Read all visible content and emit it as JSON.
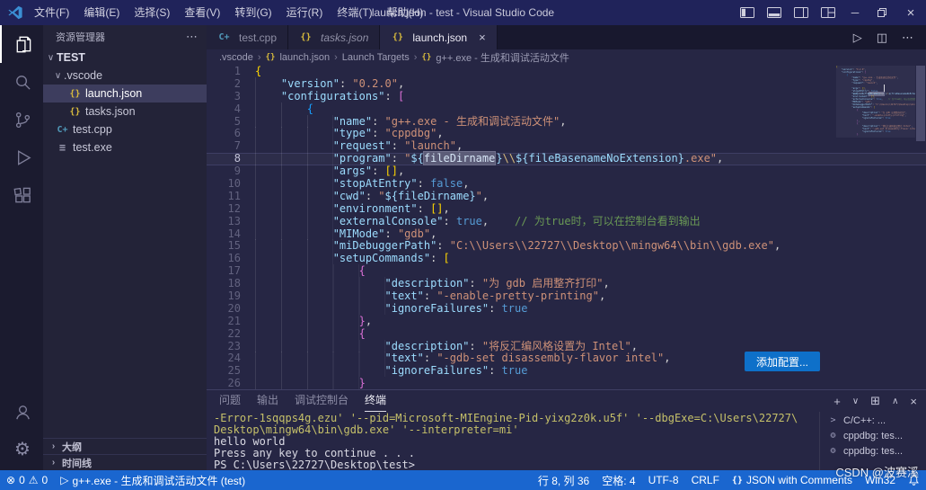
{
  "window": {
    "title": "launch.json - test - Visual Studio Code"
  },
  "menu_bar": {
    "items": [
      "文件(F)",
      "编辑(E)",
      "选择(S)",
      "查看(V)",
      "转到(G)",
      "运行(R)",
      "终端(T)",
      "帮助(H)"
    ]
  },
  "activity_bar": {
    "icons": [
      "explorer",
      "search",
      "source-control",
      "run-and-debug",
      "extensions"
    ],
    "bottom": [
      "account",
      "settings"
    ]
  },
  "explorer": {
    "header": "资源管理器",
    "tree": [
      {
        "label": "TEST",
        "chevron": "down",
        "pad": 2,
        "bold": true
      },
      {
        "label": ".vscode",
        "chevron": "down",
        "pad": 10
      },
      {
        "label": "launch.json",
        "icon": "json",
        "pad": 28,
        "selected": true
      },
      {
        "label": "tasks.json",
        "icon": "json",
        "pad": 28
      },
      {
        "label": "test.cpp",
        "icon": "cpp",
        "pad": 14
      },
      {
        "label": "test.exe",
        "icon": "exe",
        "pad": 14
      }
    ],
    "sections": [
      "大纲",
      "时间线"
    ]
  },
  "tabs": [
    {
      "label": "test.cpp",
      "icon": "cpp"
    },
    {
      "label": "tasks.json",
      "icon": "json",
      "italic": true
    },
    {
      "label": "launch.json",
      "icon": "json",
      "active": true
    }
  ],
  "breadcrumb": [
    {
      "label": ".vscode"
    },
    {
      "label": "launch.json",
      "icon": "json"
    },
    {
      "label": "Launch Targets"
    },
    {
      "label": "g++.exe - 生成和调试活动文件",
      "icon": "json"
    }
  ],
  "editor": {
    "add_config_label": "添加配置...",
    "code_lines": [
      {
        "n": "1",
        "tokens": [
          [
            "b1",
            "{"
          ]
        ]
      },
      {
        "n": "2",
        "tokens": [
          [
            "ind",
            "    "
          ],
          [
            "key",
            "\"version\""
          ],
          [
            "pun",
            ": "
          ],
          [
            "str",
            "\"0.2.0\""
          ],
          [
            "pun",
            ","
          ]
        ]
      },
      {
        "n": "3",
        "tokens": [
          [
            "ind",
            "    "
          ],
          [
            "key",
            "\"configurations\""
          ],
          [
            "pun",
            ": "
          ],
          [
            "b2",
            "["
          ]
        ]
      },
      {
        "n": "4",
        "tokens": [
          [
            "ind",
            "        "
          ],
          [
            "b3",
            "{"
          ]
        ]
      },
      {
        "n": "5",
        "tokens": [
          [
            "ind",
            "            "
          ],
          [
            "key",
            "\"name\""
          ],
          [
            "pun",
            ": "
          ],
          [
            "str",
            "\"g++.exe - 生成和调试活动文件\""
          ],
          [
            "pun",
            ","
          ]
        ]
      },
      {
        "n": "6",
        "tokens": [
          [
            "ind",
            "            "
          ],
          [
            "key",
            "\"type\""
          ],
          [
            "pun",
            ": "
          ],
          [
            "str",
            "\"cppdbg\""
          ],
          [
            "pun",
            ","
          ]
        ]
      },
      {
        "n": "7",
        "tokens": [
          [
            "ind",
            "            "
          ],
          [
            "key",
            "\"request\""
          ],
          [
            "pun",
            ": "
          ],
          [
            "str",
            "\"launch\""
          ],
          [
            "pun",
            ","
          ]
        ]
      },
      {
        "n": "8",
        "active": true,
        "tokens": [
          [
            "ind",
            "            "
          ],
          [
            "key",
            "\"program\""
          ],
          [
            "pun",
            ": "
          ],
          [
            "str",
            "\""
          ],
          [
            "var",
            "${"
          ],
          [
            "hlv",
            "fileDirname"
          ],
          [
            "cur",
            ""
          ],
          [
            "var",
            "}"
          ],
          [
            "esc",
            "\\\\"
          ],
          [
            "var",
            "${fileBasenameNoExtension}"
          ],
          [
            "str",
            ".exe\""
          ],
          [
            "pun",
            ","
          ]
        ]
      },
      {
        "n": "9",
        "tokens": [
          [
            "ind",
            "            "
          ],
          [
            "key",
            "\"args\""
          ],
          [
            "pun",
            ": "
          ],
          [
            "b1",
            "[]"
          ],
          [
            "pun",
            ","
          ]
        ]
      },
      {
        "n": "10",
        "tokens": [
          [
            "ind",
            "            "
          ],
          [
            "key",
            "\"stopAtEntry\""
          ],
          [
            "pun",
            ": "
          ],
          [
            "kw",
            "false"
          ],
          [
            "pun",
            ","
          ]
        ]
      },
      {
        "n": "11",
        "tokens": [
          [
            "ind",
            "            "
          ],
          [
            "key",
            "\"cwd\""
          ],
          [
            "pun",
            ": "
          ],
          [
            "str",
            "\""
          ],
          [
            "var",
            "${fileDirname}"
          ],
          [
            "str",
            "\""
          ],
          [
            "pun",
            ","
          ]
        ]
      },
      {
        "n": "12",
        "tokens": [
          [
            "ind",
            "            "
          ],
          [
            "key",
            "\"environment\""
          ],
          [
            "pun",
            ": "
          ],
          [
            "b1",
            "[]"
          ],
          [
            "pun",
            ","
          ]
        ]
      },
      {
        "n": "13",
        "tokens": [
          [
            "ind",
            "            "
          ],
          [
            "key",
            "\"externalConsole\""
          ],
          [
            "pun",
            ": "
          ],
          [
            "kw",
            "true"
          ],
          [
            "pun",
            ","
          ],
          [
            "com",
            "    // 为true时，可以在控制台看到输出"
          ]
        ]
      },
      {
        "n": "14",
        "tokens": [
          [
            "ind",
            "            "
          ],
          [
            "key",
            "\"MIMode\""
          ],
          [
            "pun",
            ": "
          ],
          [
            "str",
            "\"gdb\""
          ],
          [
            "pun",
            ","
          ]
        ]
      },
      {
        "n": "15",
        "tokens": [
          [
            "ind",
            "            "
          ],
          [
            "key",
            "\"miDebuggerPath\""
          ],
          [
            "pun",
            ": "
          ],
          [
            "str",
            "\"C:\\\\Users\\\\22727\\\\Desktop\\\\mingw64\\\\bin\\\\gdb.exe\""
          ],
          [
            "pun",
            ","
          ]
        ]
      },
      {
        "n": "16",
        "tokens": [
          [
            "ind",
            "            "
          ],
          [
            "key",
            "\"setupCommands\""
          ],
          [
            "pun",
            ": "
          ],
          [
            "b1",
            "["
          ]
        ]
      },
      {
        "n": "17",
        "tokens": [
          [
            "ind",
            "                "
          ],
          [
            "b2",
            "{"
          ]
        ]
      },
      {
        "n": "18",
        "tokens": [
          [
            "ind",
            "                    "
          ],
          [
            "key",
            "\"description\""
          ],
          [
            "pun",
            ": "
          ],
          [
            "str",
            "\"为 gdb 启用整齐打印\""
          ],
          [
            "pun",
            ","
          ]
        ]
      },
      {
        "n": "19",
        "tokens": [
          [
            "ind",
            "                    "
          ],
          [
            "key",
            "\"text\""
          ],
          [
            "pun",
            ": "
          ],
          [
            "str",
            "\"-enable-pretty-printing\""
          ],
          [
            "pun",
            ","
          ]
        ]
      },
      {
        "n": "20",
        "tokens": [
          [
            "ind",
            "                    "
          ],
          [
            "key",
            "\"ignoreFailures\""
          ],
          [
            "pun",
            ": "
          ],
          [
            "kw",
            "true"
          ]
        ]
      },
      {
        "n": "21",
        "tokens": [
          [
            "ind",
            "                "
          ],
          [
            "b2",
            "}"
          ],
          [
            "pun",
            ","
          ]
        ]
      },
      {
        "n": "22",
        "tokens": [
          [
            "ind",
            "                "
          ],
          [
            "b2",
            "{"
          ]
        ]
      },
      {
        "n": "23",
        "tokens": [
          [
            "ind",
            "                    "
          ],
          [
            "key",
            "\"description\""
          ],
          [
            "pun",
            ": "
          ],
          [
            "str",
            "\"将反汇编风格设置为 Intel\""
          ],
          [
            "pun",
            ","
          ]
        ]
      },
      {
        "n": "24",
        "tokens": [
          [
            "ind",
            "                    "
          ],
          [
            "key",
            "\"text\""
          ],
          [
            "pun",
            ": "
          ],
          [
            "str",
            "\"-gdb-set disassembly-flavor intel\""
          ],
          [
            "pun",
            ","
          ]
        ]
      },
      {
        "n": "25",
        "tokens": [
          [
            "ind",
            "                    "
          ],
          [
            "key",
            "\"ignoreFailures\""
          ],
          [
            "pun",
            ": "
          ],
          [
            "kw",
            "true"
          ]
        ]
      },
      {
        "n": "26",
        "tokens": [
          [
            "ind",
            "                "
          ],
          [
            "b2",
            "}"
          ]
        ]
      }
    ]
  },
  "panel": {
    "tabs": [
      {
        "label": "问题"
      },
      {
        "label": "输出"
      },
      {
        "label": "调试控制台"
      },
      {
        "label": "终端",
        "active": true
      }
    ],
    "terminal_lines": [
      {
        "cls": "yellow",
        "text": "-Error-1sqqps4g.ezu' '--pid=Microsoft-MIEngine-Pid-yixg2z0k.u5f' '--dbgExe=C:\\Users\\22727\\"
      },
      {
        "cls": "yellow",
        "text": "Desktop\\mingw64\\bin\\gdb.exe' '--interpreter=mi'"
      },
      {
        "cls": "plain",
        "text": "hello world"
      },
      {
        "cls": "plain",
        "text": "Press any key to continue . . ."
      },
      {
        "cls": "plain",
        "text": "PS C:\\Users\\22727\\Desktop\\test>"
      }
    ],
    "sessions": [
      {
        "label": "C/C++: ...",
        "icon": "terminal"
      },
      {
        "label": "cppdbg: tes...",
        "icon": "debug"
      },
      {
        "label": "cppdbg: tes...",
        "icon": "debug"
      }
    ]
  },
  "status_bar": {
    "errors": "0",
    "warnings": "0",
    "debug_target": "g++.exe - 生成和调试活动文件 (test)",
    "line_col": "行 8, 列 36",
    "indent": "空格: 4",
    "encoding": "UTF-8",
    "eol": "CRLF",
    "language": "JSON with Comments",
    "platform": "Win32"
  },
  "watermark": "CSDN @波赛溪",
  "colors": {
    "title_bar": "#20235a",
    "status_bar": "#1a66cf",
    "accent_button": "#0e70c9",
    "editor_bg": "#262644",
    "string": "#ce9178",
    "key": "#9cdcfe",
    "comment": "#6a9955"
  }
}
